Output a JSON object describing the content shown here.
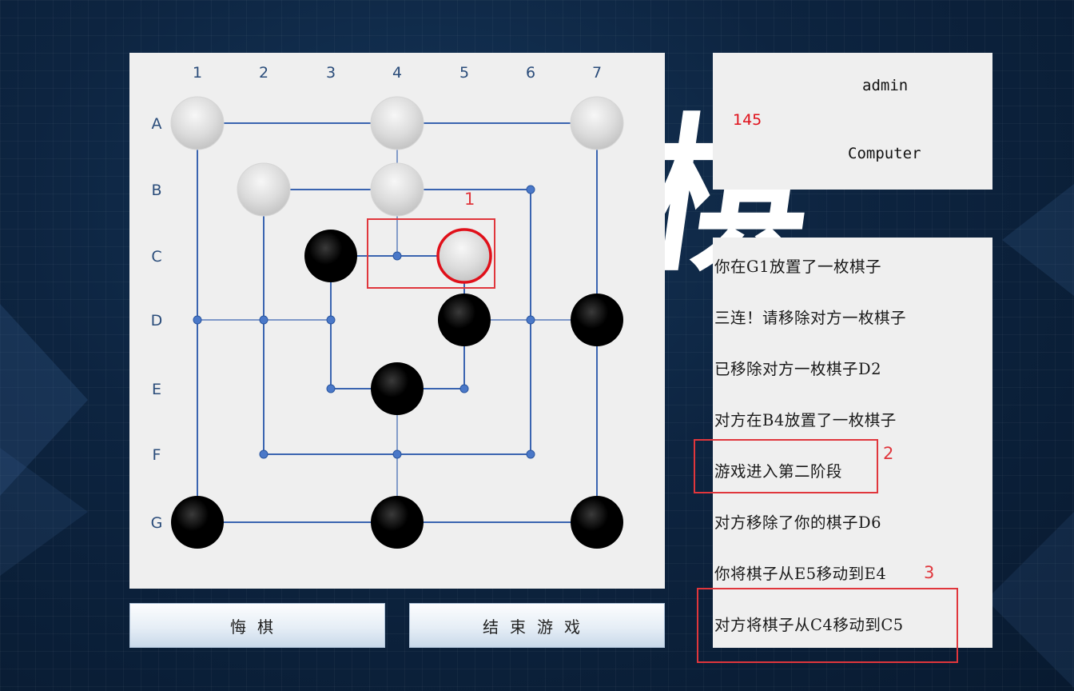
{
  "board": {
    "columns": [
      "1",
      "2",
      "3",
      "4",
      "5",
      "6",
      "7"
    ],
    "rows": [
      "A",
      "B",
      "C",
      "D",
      "E",
      "F",
      "G"
    ],
    "pieces": [
      {
        "pos": "A1",
        "color": "white"
      },
      {
        "pos": "A4",
        "color": "white"
      },
      {
        "pos": "A7",
        "color": "white"
      },
      {
        "pos": "B2",
        "color": "white"
      },
      {
        "pos": "B4",
        "color": "white"
      },
      {
        "pos": "C3",
        "color": "black"
      },
      {
        "pos": "C5",
        "color": "white",
        "highlighted": true
      },
      {
        "pos": "D5",
        "color": "black"
      },
      {
        "pos": "D7",
        "color": "black"
      },
      {
        "pos": "E4",
        "color": "black"
      },
      {
        "pos": "G1",
        "color": "black"
      },
      {
        "pos": "G4",
        "color": "black"
      },
      {
        "pos": "G7",
        "color": "black"
      }
    ],
    "empty_points": [
      "B6",
      "C4",
      "D1",
      "D2",
      "D3",
      "D6",
      "E3",
      "E5",
      "F2",
      "F4",
      "F6"
    ]
  },
  "buttons": {
    "undo": "悔棋",
    "end_game": "结束游戏"
  },
  "players": {
    "player1": "admin",
    "score": "145",
    "player2": "Computer"
  },
  "log": [
    "你在G1放置了一枚棋子",
    "三连！请移除对方一枚棋子",
    "已移除对方一枚棋子D2",
    "对方在B4放置了一枚棋子",
    "游戏进入第二阶段",
    "对方移除了你的棋子D6",
    "你将棋子从E5移动到E4",
    "对方将棋子从C4移动到C5"
  ],
  "annotations": [
    "1",
    "2",
    "3"
  ],
  "colors": {
    "board_line": "#3a64b0",
    "highlight": "#e0101a",
    "annotation": "#e0363c"
  }
}
